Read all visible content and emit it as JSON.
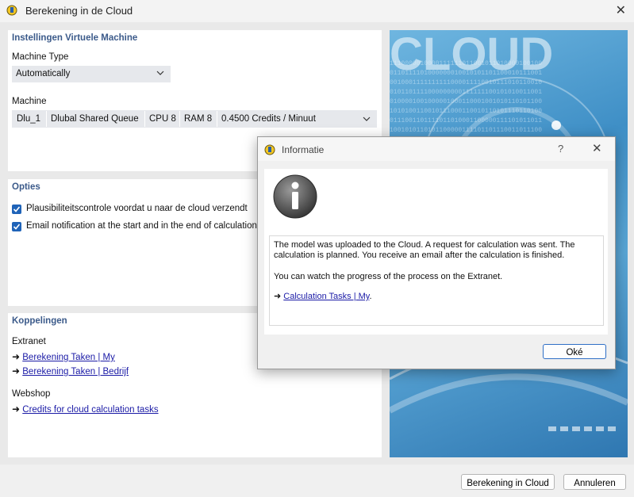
{
  "window": {
    "title": "Berekening in de Cloud",
    "close_glyph": "✕"
  },
  "vm": {
    "section_title": "Instellingen Virtuele Machine",
    "machine_type_label": "Machine Type",
    "machine_type_value": "Automatically",
    "machine_label": "Machine",
    "machine": {
      "name": "Dlu_1",
      "queue": "Dlubal Shared Queue",
      "cpu": "CPU 8",
      "ram": "RAM 8",
      "credits": "0.4500 Credits / Minuut"
    }
  },
  "options": {
    "section_title": "Opties",
    "items": [
      {
        "label": "Plausibiliteitscontrole voordat u naar de cloud verzendt",
        "checked": true
      },
      {
        "label": "Email notification at the start and in the end of calculation",
        "checked": true
      }
    ]
  },
  "links": {
    "section_title": "Koppelingen",
    "extranet_label": "Extranet",
    "extranet_links": [
      "Berekening Taken | My",
      "Berekening Taken | Bedrijf"
    ],
    "webshop_label": "Webshop",
    "webshop_links": [
      "Credits for cloud calculation tasks"
    ],
    "arrow": "➜"
  },
  "footer": {
    "calculate_label": "Berekening in Cloud",
    "cancel_label": "Annuleren"
  },
  "dialog": {
    "title": "Informatie",
    "help_glyph": "?",
    "close_glyph": "✕",
    "message_line1": "The model was uploaded to the Cloud. A request for calculation was sent. The calculation is planned. You receive an email after the calculation is finished.",
    "message_line2": "You can watch the progress of the process on the Extranet.",
    "link_label": "Calculation Tasks | My",
    "link_suffix": ".",
    "arrow": "➜",
    "ok_label": "Oké"
  },
  "colors": {
    "accent": "#1f63b8",
    "section_title": "#3b5a8a",
    "link": "#1a1aa6"
  },
  "icons": {
    "app": "dlubal-app-icon",
    "info": "info-icon",
    "chevron": "chevron-down-icon",
    "check": "checkmark-icon"
  }
}
